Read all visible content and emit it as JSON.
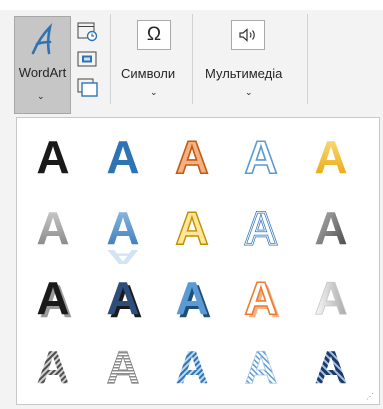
{
  "ribbon": {
    "wordart_label": "WordArt",
    "symbols_label": "Символи",
    "multimedia_label": "Мультимедіа",
    "symbols_icon_glyph": "Ω",
    "chevron": "⌄"
  },
  "icons": [
    "wordart-icon",
    "date-time-icon",
    "object-icon",
    "text-box-icon",
    "omega-icon",
    "speaker-icon"
  ],
  "gallery": {
    "rows": [
      [
        {
          "letter": "A",
          "name": "wordart-style-black-fill"
        },
        {
          "letter": "A",
          "name": "wordart-style-blue-fill"
        },
        {
          "letter": "A",
          "name": "wordart-style-orange-outline"
        },
        {
          "letter": "A",
          "name": "wordart-style-blue-outline"
        },
        {
          "letter": "A",
          "name": "wordart-style-gold-gradient"
        }
      ],
      [
        {
          "letter": "A",
          "name": "wordart-style-gray-gradient"
        },
        {
          "letter": "A",
          "name": "wordart-style-blue-reflection"
        },
        {
          "letter": "A",
          "name": "wordart-style-yellow-outline"
        },
        {
          "letter": "A",
          "name": "wordart-style-blue-double-outline"
        },
        {
          "letter": "A",
          "name": "wordart-style-dark-gray"
        }
      ],
      [
        {
          "letter": "A",
          "name": "wordart-style-black-shadow"
        },
        {
          "letter": "A",
          "name": "wordart-style-blue-shadow"
        },
        {
          "letter": "A",
          "name": "wordart-style-lightblue-shadow"
        },
        {
          "letter": "A",
          "name": "wordart-style-orange-white-shadow"
        },
        {
          "letter": "A",
          "name": "wordart-style-silver"
        }
      ],
      [
        {
          "letter": "A",
          "name": "wordart-style-gray-pattern"
        },
        {
          "letter": "A",
          "name": "wordart-style-gray-striped"
        },
        {
          "letter": "A",
          "name": "wordart-style-blue-pattern"
        },
        {
          "letter": "A",
          "name": "wordart-style-lightblue-pattern"
        },
        {
          "letter": "A",
          "name": "wordart-style-navy-pattern"
        }
      ]
    ]
  },
  "colors": {
    "accent": "#2e74b5",
    "orange": "#ed7d31",
    "gold": "#ffc000",
    "gray": "#7f7f7f",
    "selected_bg": "#c6c6c6"
  }
}
